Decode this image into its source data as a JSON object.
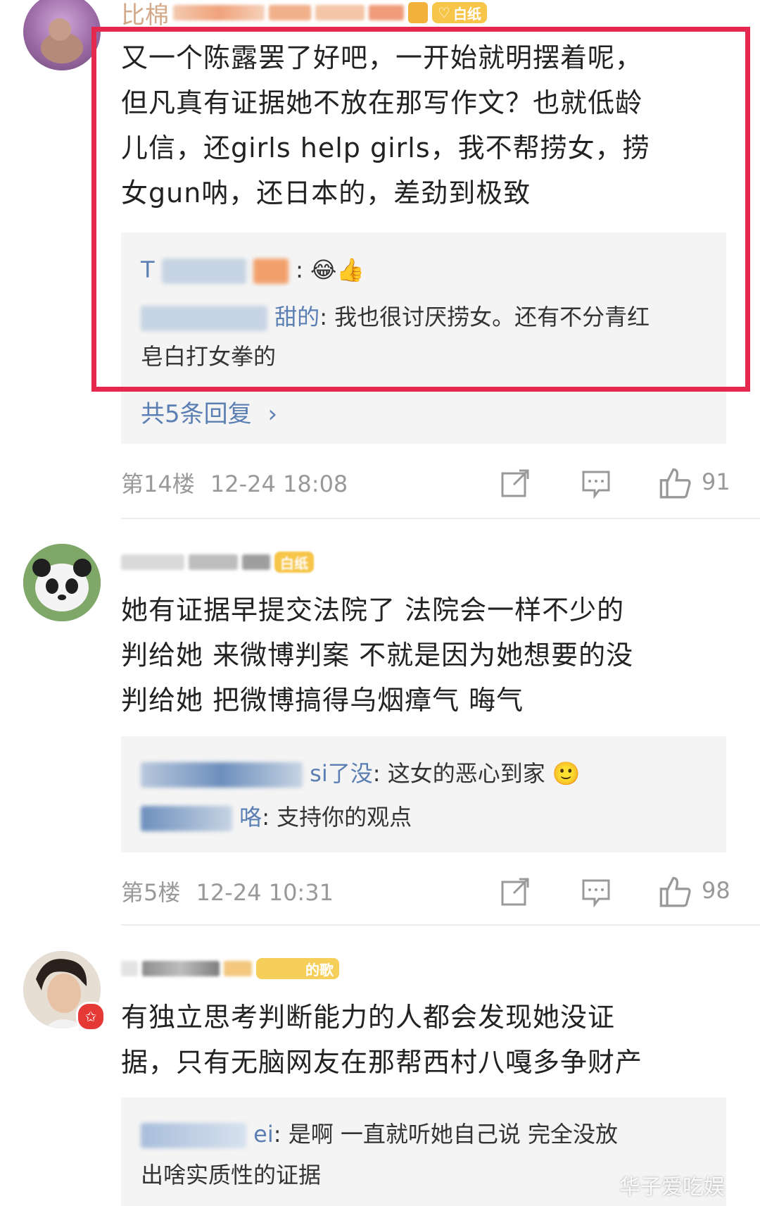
{
  "comments": [
    {
      "name_fragment": "比棉",
      "badge": "白纸",
      "text_lines": [
        "又一个陈露罢了好吧，一开始就明摆着呢，",
        "但凡真有证据她不放在那写作文？也就低龄",
        "儿信，还girls help girls，我不帮捞女，捞",
        "女gun呐，还日本的，差劲到极致"
      ],
      "replies": [
        {
          "user_visible": "T",
          "text": ":"
        },
        {
          "user_visible": "甜的",
          "text": ": 我也很讨厌捞女。还有不分青红"
        },
        {
          "user_visible": "",
          "text": "皂白打女拳的"
        }
      ],
      "more_replies": "共5条回复",
      "floor": "第14楼",
      "time": "12-24 18:08",
      "likes": "91"
    },
    {
      "name_fragment": "",
      "badge": "白纸",
      "text_lines": [
        "她有证据早提交法院了 法院会一样不少的",
        "判给她 来微博判案 不就是因为她想要的没",
        "判给她 把微博搞得乌烟瘴气 晦气"
      ],
      "replies": [
        {
          "user_visible": "si了没",
          "text": ": 这女的恶心到家"
        },
        {
          "user_visible": "咯",
          "text": ": 支持你的观点"
        }
      ],
      "floor": "第5楼",
      "time": "12-24 10:31",
      "likes": "98"
    },
    {
      "name_fragment": "",
      "badge": "的歌",
      "text_lines": [
        "有独立思考判断能力的人都会发现她没证",
        "据，只有无脑网友在那帮西村八嘎多争财产"
      ],
      "replies": [
        {
          "user_visible": "ei",
          "text": ": 是啊 一直就听她自己说 完全没放"
        },
        {
          "user_visible": "",
          "text": "出啥实质性的证据"
        }
      ]
    }
  ],
  "watermark": "华子爱吃娱",
  "colors": {
    "highlight_frame": "#e5294e",
    "link": "#5b7fb3",
    "meta": "#999999",
    "badge": "#f6c54a"
  }
}
